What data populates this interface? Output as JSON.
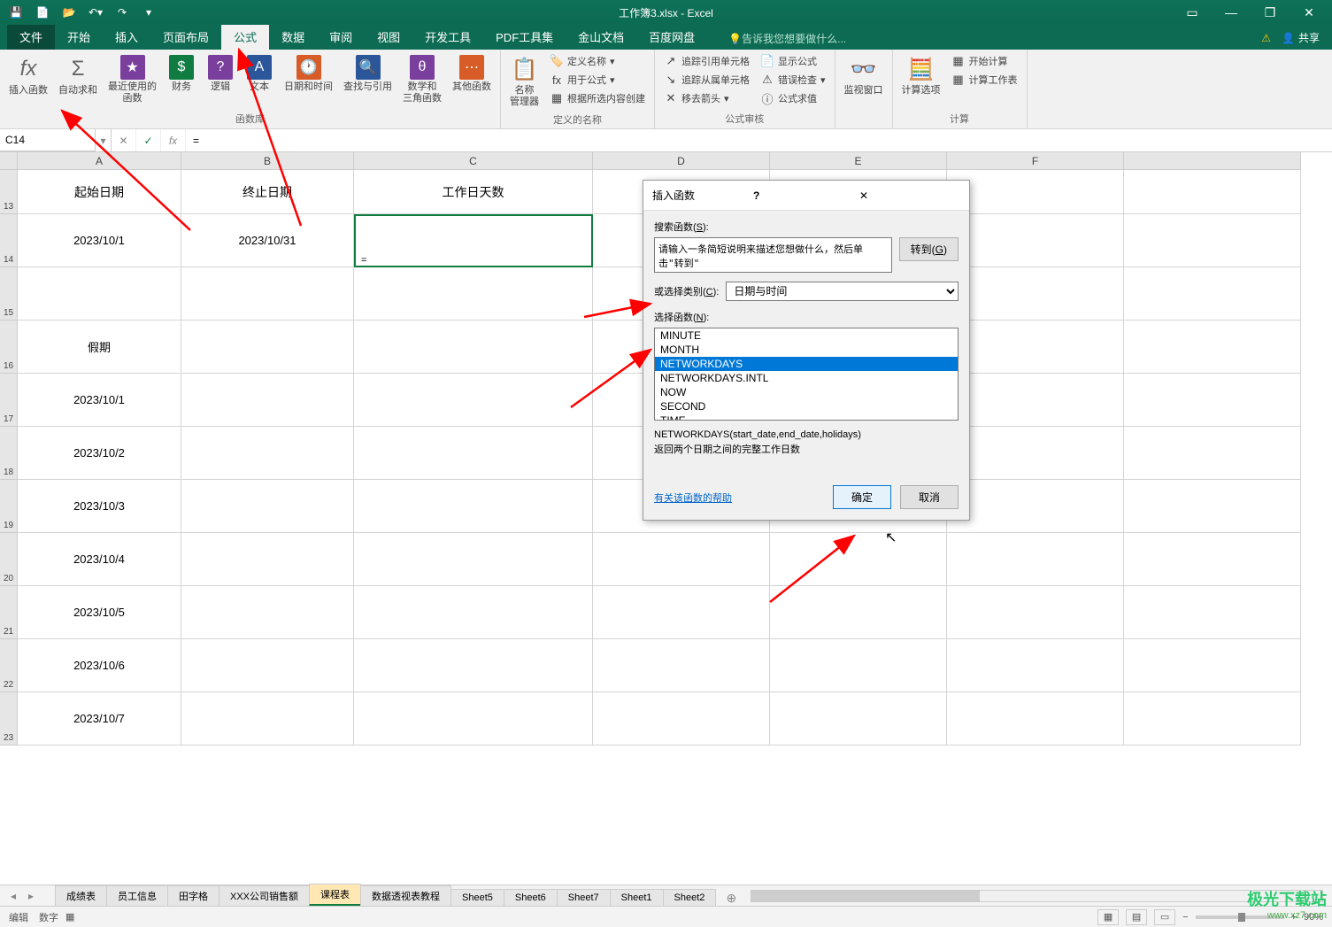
{
  "title": "工作簿3.xlsx - Excel",
  "menutabs": [
    "文件",
    "开始",
    "插入",
    "页面布局",
    "公式",
    "数据",
    "审阅",
    "视图",
    "开发工具",
    "PDF工具集",
    "金山文档",
    "百度网盘"
  ],
  "active_tab_index": 4,
  "tell_me": "告诉我您想要做什么...",
  "share": "共享",
  "ribbon": {
    "insert_fn": "插入函数",
    "autosum": "自动求和",
    "recent": "最近使用的\n函数",
    "financial": "财务",
    "logical": "逻辑",
    "text": "文本",
    "datetime": "日期和时间",
    "lookup": "查找与引用",
    "math": "数学和\n三角函数",
    "other": "其他函数",
    "group_lib": "函数库",
    "name_mgr": "名称\n管理器",
    "define_name": "定义名称",
    "use_in_formula": "用于公式",
    "create_from_sel": "根据所选内容创建",
    "group_names": "定义的名称",
    "trace_prec": "追踪引用单元格",
    "trace_dep": "追踪从属单元格",
    "remove_arrows": "移去箭头",
    "show_formulas": "显示公式",
    "error_check": "错误检查",
    "eval_formula": "公式求值",
    "group_audit": "公式审核",
    "watch": "监视窗口",
    "calc_opts": "计算选项",
    "calc_now": "开始计算",
    "calc_sheet": "计算工作表",
    "group_calc": "计算"
  },
  "namebox": "C14",
  "formula_value": "=",
  "columns": [
    "A",
    "B",
    "C",
    "D",
    "E",
    "F"
  ],
  "rows": [
    "13",
    "14",
    "15",
    "16",
    "17",
    "18",
    "19",
    "20",
    "21",
    "22",
    "23"
  ],
  "cells": {
    "A13": "起始日期",
    "B13": "终止日期",
    "C13": "工作日天数",
    "A14": "2023/10/1",
    "B14": "2023/10/31",
    "C14": "=",
    "A16": "假期",
    "A17": "2023/10/1",
    "A18": "2023/10/2",
    "A19": "2023/10/3",
    "A20": "2023/10/4",
    "A21": "2023/10/5",
    "A22": "2023/10/6",
    "A23": "2023/10/7"
  },
  "dialog": {
    "title": "插入函数",
    "search_label": "搜索函数(S):",
    "search_placeholder": "请输入一条简短说明来描述您想做什么，然后单击\"转到\"",
    "goto": "转到(G)",
    "category_label": "或选择类别(C):",
    "category_value": "日期与时间",
    "select_label": "选择函数(N):",
    "functions": [
      "MINUTE",
      "MONTH",
      "NETWORKDAYS",
      "NETWORKDAYS.INTL",
      "NOW",
      "SECOND",
      "TIME"
    ],
    "selected_index": 2,
    "syntax": "NETWORKDAYS(start_date,end_date,holidays)",
    "desc": "返回两个日期之间的完整工作日数",
    "help_link": "有关该函数的帮助",
    "ok": "确定",
    "cancel": "取消"
  },
  "sheets": [
    "成绩表",
    "员工信息",
    "田字格",
    "XXX公司销售额",
    "课程表",
    "数据透视表教程",
    "Sheet5",
    "Sheet6",
    "Sheet7",
    "Sheet1",
    "Sheet2"
  ],
  "active_sheet_index": 4,
  "status": {
    "mode": "编辑",
    "extra": "数字",
    "zoom": "90%"
  },
  "watermark": {
    "brand": "极光下载站",
    "url": "www.xz7.com"
  }
}
